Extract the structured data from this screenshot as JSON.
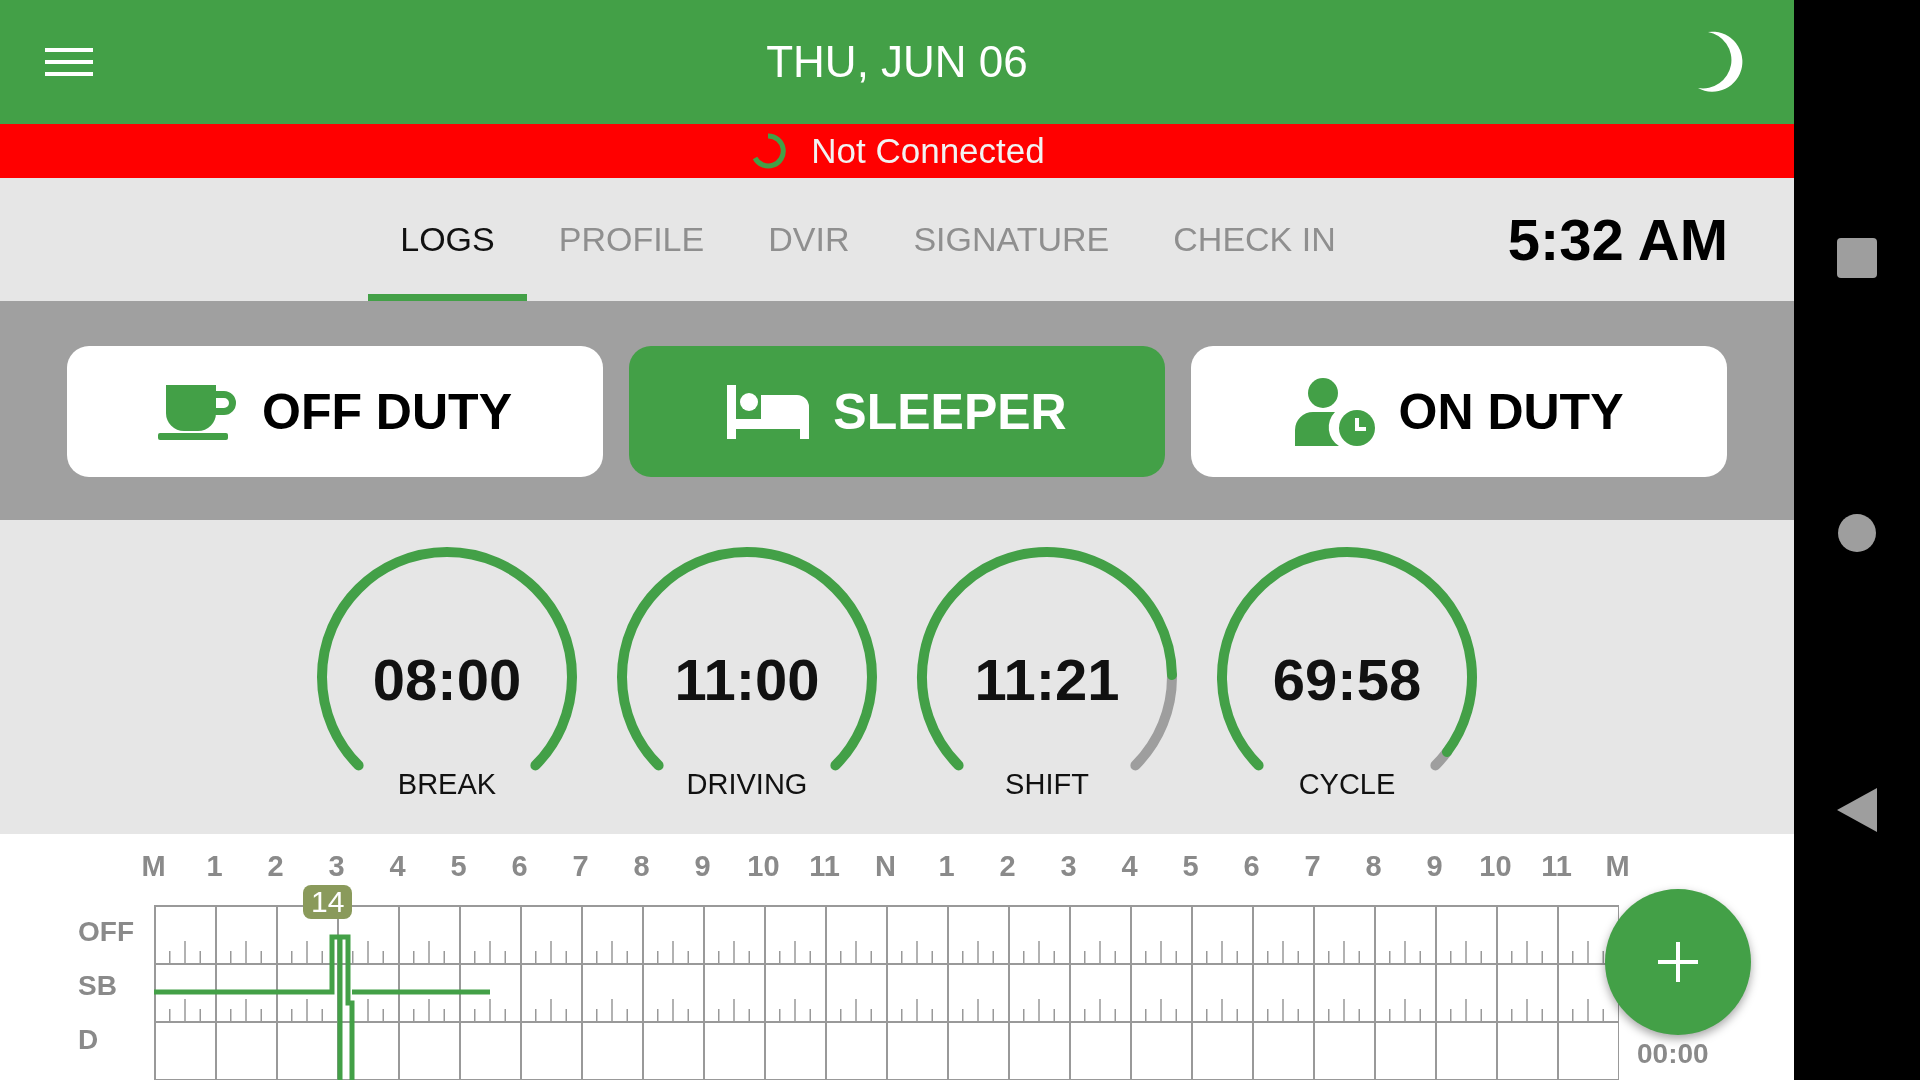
{
  "header": {
    "title": "THU, JUN 06"
  },
  "connection": {
    "status": "Not Connected"
  },
  "tabs": [
    {
      "label": "LOGS",
      "selected": true
    },
    {
      "label": "PROFILE",
      "selected": false
    },
    {
      "label": "DVIR",
      "selected": false
    },
    {
      "label": "SIGNATURE",
      "selected": false
    },
    {
      "label": "CHECK IN",
      "selected": false
    }
  ],
  "time": "5:32 AM",
  "status_buttons": [
    {
      "kind": "off",
      "label": "OFF DUTY",
      "selected": false
    },
    {
      "kind": "sleeper",
      "label": "SLEEPER",
      "selected": true
    },
    {
      "kind": "on",
      "label": "ON DUTY",
      "selected": false
    }
  ],
  "gauges": [
    {
      "value": "08:00",
      "label": "BREAK"
    },
    {
      "value": "11:00",
      "label": "DRIVING"
    },
    {
      "value": "11:21",
      "label": "SHIFT"
    },
    {
      "value": "69:58",
      "label": "CYCLE"
    }
  ],
  "log_chart": {
    "hour_labels": [
      "M",
      "1",
      "2",
      "3",
      "4",
      "5",
      "6",
      "7",
      "8",
      "9",
      "10",
      "11",
      "N",
      "1",
      "2",
      "3",
      "4",
      "5",
      "6",
      "7",
      "8",
      "9",
      "10",
      "11",
      "M"
    ],
    "rows": [
      "OFF",
      "SB",
      "D"
    ],
    "marker": "14",
    "total": "00:00"
  }
}
